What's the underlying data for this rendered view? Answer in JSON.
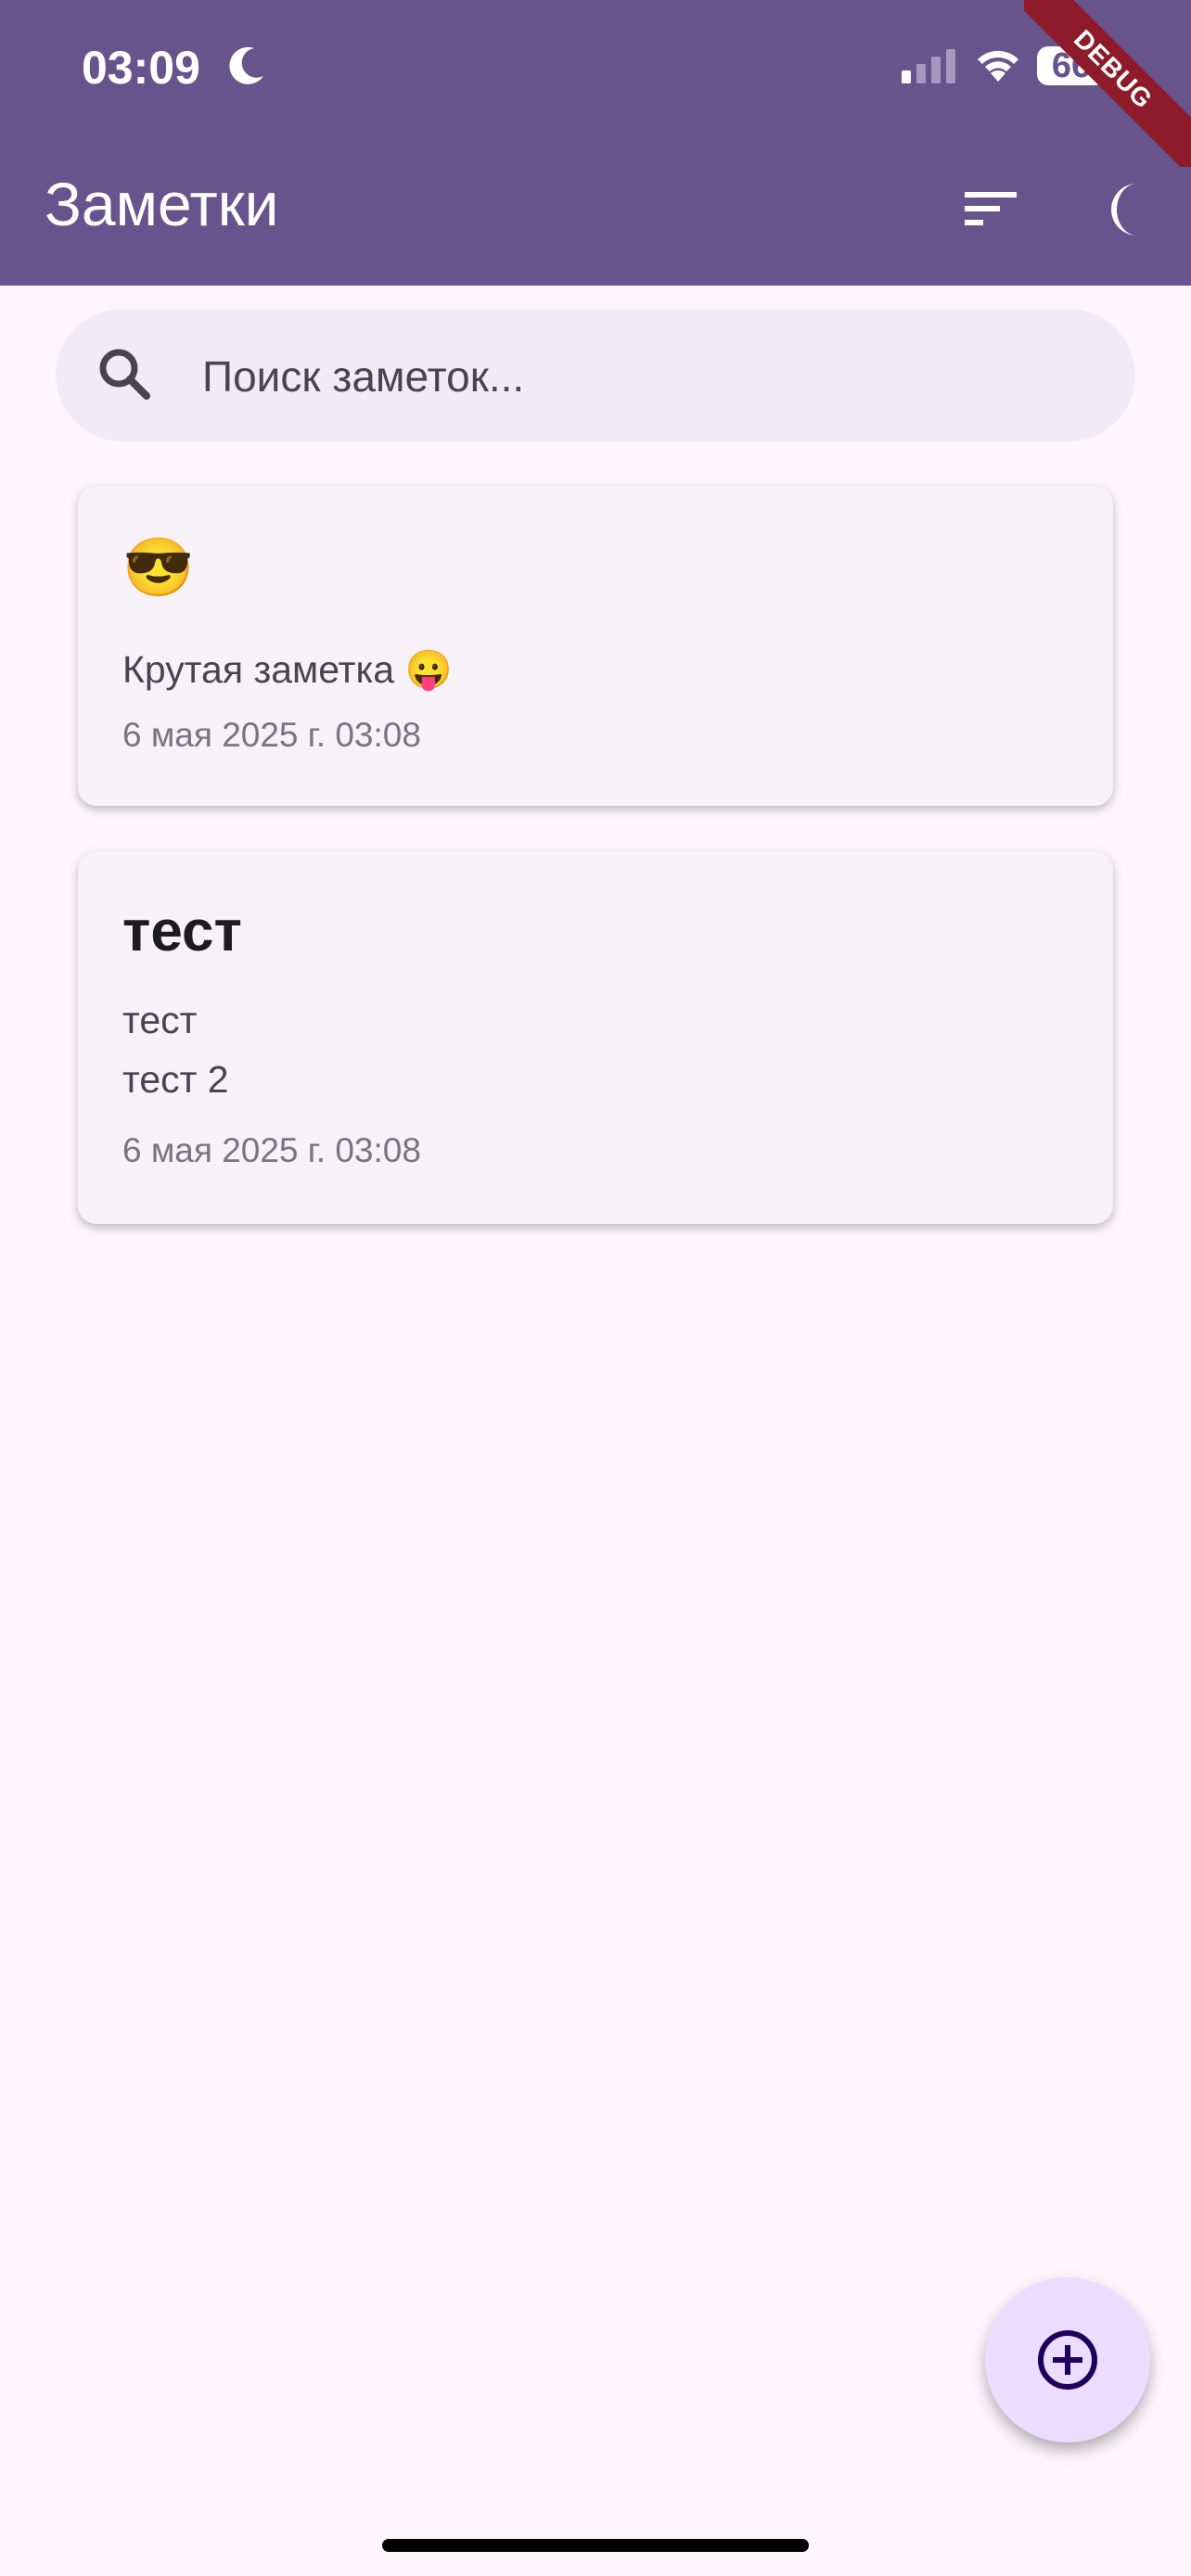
{
  "status_bar": {
    "time": "03:09",
    "battery": "66",
    "moon_icon": "moon-icon",
    "signal_icon": "cellular-signal-icon",
    "wifi_icon": "wifi-icon"
  },
  "debug_banner": "DEBUG",
  "app_bar": {
    "title": "Заметки",
    "sort_icon": "sort-icon",
    "theme_icon": "dark-mode-icon",
    "background": "#68548d"
  },
  "search": {
    "placeholder": "Поиск заметок...",
    "value": "",
    "icon": "search-icon"
  },
  "notes": [
    {
      "title": "😎",
      "body": "Крутая заметка 😛",
      "date": "6 мая 2025 г. 03:08"
    },
    {
      "title": "тест",
      "body": "тест\nтест 2",
      "date": "6 мая 2025 г. 03:08"
    }
  ],
  "fab": {
    "icon": "add-circle-icon",
    "background": "#eaddff"
  }
}
